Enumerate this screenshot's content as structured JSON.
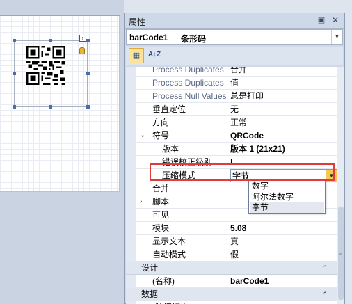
{
  "panel": {
    "title": "属性",
    "pin_icon": "pin-icon",
    "close_icon": "close-icon"
  },
  "object_selector": {
    "name": "barCode1",
    "type": "条形码"
  },
  "toolbar": {
    "categorized_icon": "categorized-icon",
    "alphabetical_label": "A↓Z"
  },
  "properties": [
    {
      "name": "Process Duplicates I",
      "value": "合并",
      "style": "grey"
    },
    {
      "name": "Process Duplicates",
      "value": "值",
      "style": "grey"
    },
    {
      "name": "Process Null Values",
      "value": "总是打印",
      "style": "grey"
    },
    {
      "name": "垂直定位",
      "value": "无"
    },
    {
      "name": "方向",
      "value": "正常"
    },
    {
      "name": "符号",
      "value": "QRCode",
      "value_bold": true,
      "expander": "⌄"
    },
    {
      "name": "版本",
      "value": "版本 1 (21x21)",
      "value_bold": true,
      "indent": true
    },
    {
      "name": "错误校正级别",
      "value": "L",
      "indent": true
    },
    {
      "name": "压缩模式",
      "value": "字节",
      "indent": true
    },
    {
      "name": "合并",
      "value": ""
    },
    {
      "name": "脚本",
      "value": "",
      "expander": "›"
    },
    {
      "name": "可见",
      "value": ""
    },
    {
      "name": "模块",
      "value": "5.08",
      "value_bold": true
    },
    {
      "name": "显示文本",
      "value": "真"
    },
    {
      "name": "自动模式",
      "value": "假"
    }
  ],
  "categories": {
    "design": {
      "label": "设计",
      "chevron": "⌃"
    },
    "data": {
      "label": "数据",
      "chevron": "⌃"
    }
  },
  "design_rows": [
    {
      "name": "(名称)",
      "value": "barCode1",
      "value_bold": true
    }
  ],
  "data_rows": [
    {
      "name": "(数据绑定)",
      "value": "",
      "expander": "›"
    }
  ],
  "dropdown": {
    "current": "字节",
    "options": [
      "数字",
      "阿尔法数字",
      "字节"
    ],
    "selected_index": 2
  },
  "colors": {
    "highlight_border": "#e03c3c",
    "dropdown_button": "#f6c94e"
  }
}
